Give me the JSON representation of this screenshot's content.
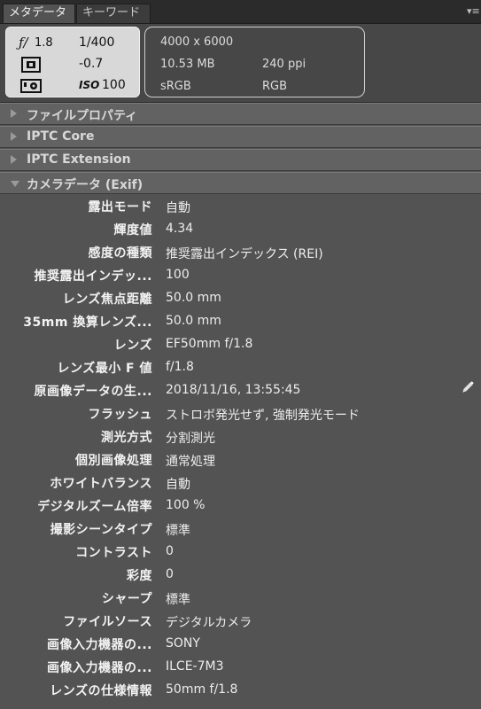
{
  "tabs": [
    {
      "label": "メタデータ",
      "active": true
    },
    {
      "label": "キーワード",
      "active": false
    }
  ],
  "panel_menu_icon": "panel-menu-icon",
  "summary": {
    "aperture": "1.8",
    "shutter": "1/400",
    "exposure_comp": "-0.7",
    "iso_label": "ISO",
    "iso": "100",
    "dimensions": "4000 x 6000",
    "file_size": "10.53 MB",
    "resolution": "240 ppi",
    "color_profile": "sRGB",
    "color_mode": "RGB"
  },
  "sections": [
    {
      "label": "ファイルプロパティ",
      "expanded": false
    },
    {
      "label": "IPTC Core",
      "expanded": false
    },
    {
      "label": "IPTC Extension",
      "expanded": false
    },
    {
      "label": "カメラデータ (Exif)",
      "expanded": true
    }
  ],
  "exif": [
    {
      "key": "露出モード",
      "value": "自動"
    },
    {
      "key": "輝度値",
      "value": "4.34"
    },
    {
      "key": "感度の種類",
      "value": "推奨露出インデックス (REI)"
    },
    {
      "key": "推奨露出インデッ...",
      "value": "100"
    },
    {
      "key": "レンズ焦点距離",
      "value": "50.0 mm"
    },
    {
      "key": "35mm 換算レンズ...",
      "value": "50.0 mm"
    },
    {
      "key": "レンズ",
      "value": "EF50mm f/1.8"
    },
    {
      "key": "レンズ最小 F 値",
      "value": "f/1.8"
    },
    {
      "key": "原画像データの生...",
      "value": "2018/11/16, 13:55:45"
    },
    {
      "key": "フラッシュ",
      "value": "ストロボ発光せず, 強制発光モード"
    },
    {
      "key": "測光方式",
      "value": "分割測光"
    },
    {
      "key": "個別画像処理",
      "value": "通常処理"
    },
    {
      "key": "ホワイトバランス",
      "value": "自動"
    },
    {
      "key": "デジタルズーム倍率",
      "value": "100 %"
    },
    {
      "key": "撮影シーンタイプ",
      "value": "標準"
    },
    {
      "key": "コントラスト",
      "value": "0"
    },
    {
      "key": "彩度",
      "value": "0"
    },
    {
      "key": "シャープ",
      "value": "標準"
    },
    {
      "key": "ファイルソース",
      "value": "デジタルカメラ"
    },
    {
      "key": "画像入力機器の...",
      "value": "SONY"
    },
    {
      "key": "画像入力機器の...",
      "value": "ILCE-7M3"
    },
    {
      "key": "レンズの仕様情報",
      "value": "50mm f/1.8"
    }
  ]
}
